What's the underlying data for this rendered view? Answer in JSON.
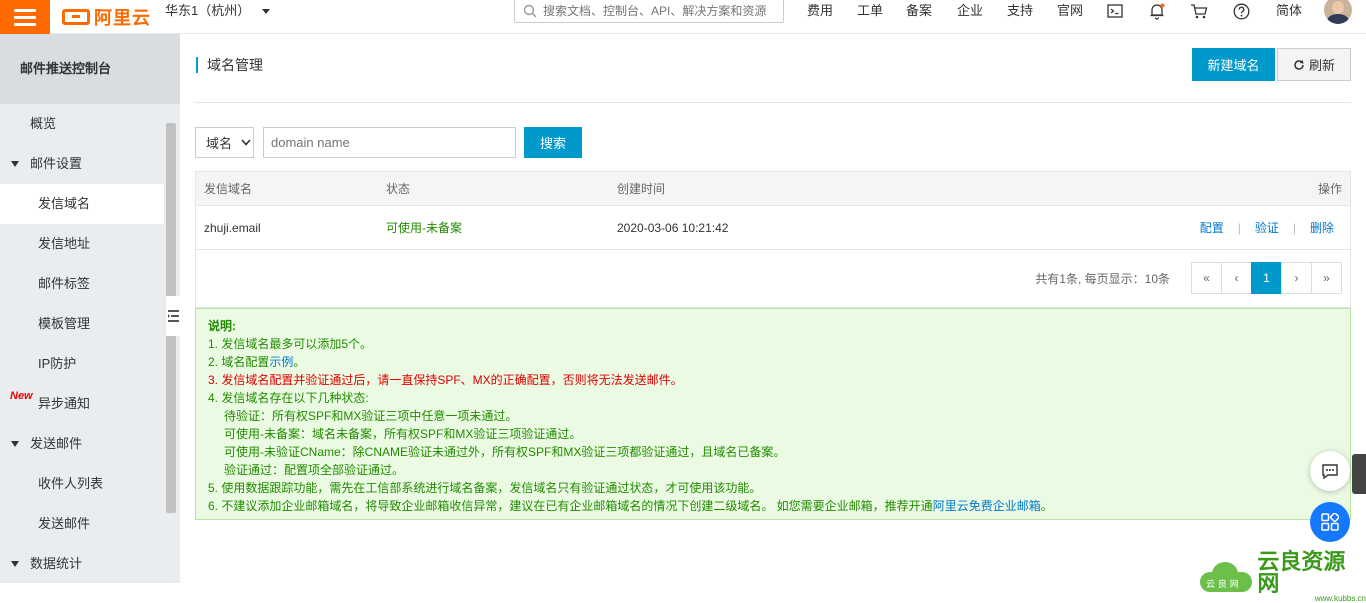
{
  "topbar": {
    "logo_text": "阿里云",
    "region": "华东1（杭州）",
    "search_placeholder": "搜索文档、控制台、API、解决方案和资源",
    "nav": [
      "费用",
      "工单",
      "备案",
      "企业",
      "支持",
      "官网"
    ],
    "lang": "简体",
    "brand_color": "#ff6a00"
  },
  "sidebar": {
    "title": "邮件推送控制台",
    "items": [
      {
        "label": "概览"
      },
      {
        "label": "邮件设置"
      },
      {
        "label": "发信域名"
      },
      {
        "label": "发信地址"
      },
      {
        "label": "邮件标签"
      },
      {
        "label": "模板管理"
      },
      {
        "label": "IP防护"
      },
      {
        "label": "异步通知",
        "badge": "New"
      },
      {
        "label": "发送邮件"
      },
      {
        "label": "收件人列表"
      },
      {
        "label": "发送邮件"
      },
      {
        "label": "数据统计"
      }
    ]
  },
  "main": {
    "title": "域名管理",
    "new_button": "新建域名",
    "refresh_button": "刷新",
    "filter": {
      "select_value": "域名",
      "input_placeholder": "domain name",
      "search_button": "搜索"
    },
    "table": {
      "headers": [
        "发信域名",
        "状态",
        "创建时间",
        "操作"
      ],
      "rows": [
        {
          "domain": "zhuji.email",
          "status": "可使用-未备案",
          "created": "2020-03-06 10:21:42",
          "actions": [
            "配置",
            "验证",
            "删除"
          ]
        }
      ],
      "pager_summary": "共有1条, 每页显示：10条",
      "pages": [
        "«",
        "‹",
        "1",
        "›",
        "»"
      ],
      "current_page": "1"
    },
    "notes": {
      "title": "说明:",
      "lines": [
        "1. 发信域名最多可以添加5个。",
        "2. 域名配置",
        "3. 发信域名配置并验证通过后，请一直保持SPF、MX的正确配置，否则将无法发送邮件。",
        "4. 发信域名存在以下几种状态:",
        "待验证：所有权SPF和MX验证三项中任意一项未通过。",
        "可使用-未备案：域名未备案，所有权SPF和MX验证三项验证通过。",
        "可使用-未验证CName：除CNAME验证未通过外，所有权SPF和MX验证三项都验证通过，且域名已备案。",
        "验证通过：配置项全部验证通过。",
        "5. 使用数据跟踪功能，需先在工信部系统进行域名备案，发信域名只有验证通过状态，才可使用该功能。",
        "6. 不建议添加企业邮箱域名，将导致企业邮箱收信异常，建议在已有企业邮箱域名的情况下创建二级域名。 如您需要企业邮箱，推荐开通"
      ],
      "link_example": "示例",
      "link_free_mail": "阿里云免费企业邮箱",
      "period": "。"
    }
  },
  "watermark": {
    "text": "云良资源网",
    "url": "www.kubbs.cn",
    "small": "云 良 网"
  }
}
